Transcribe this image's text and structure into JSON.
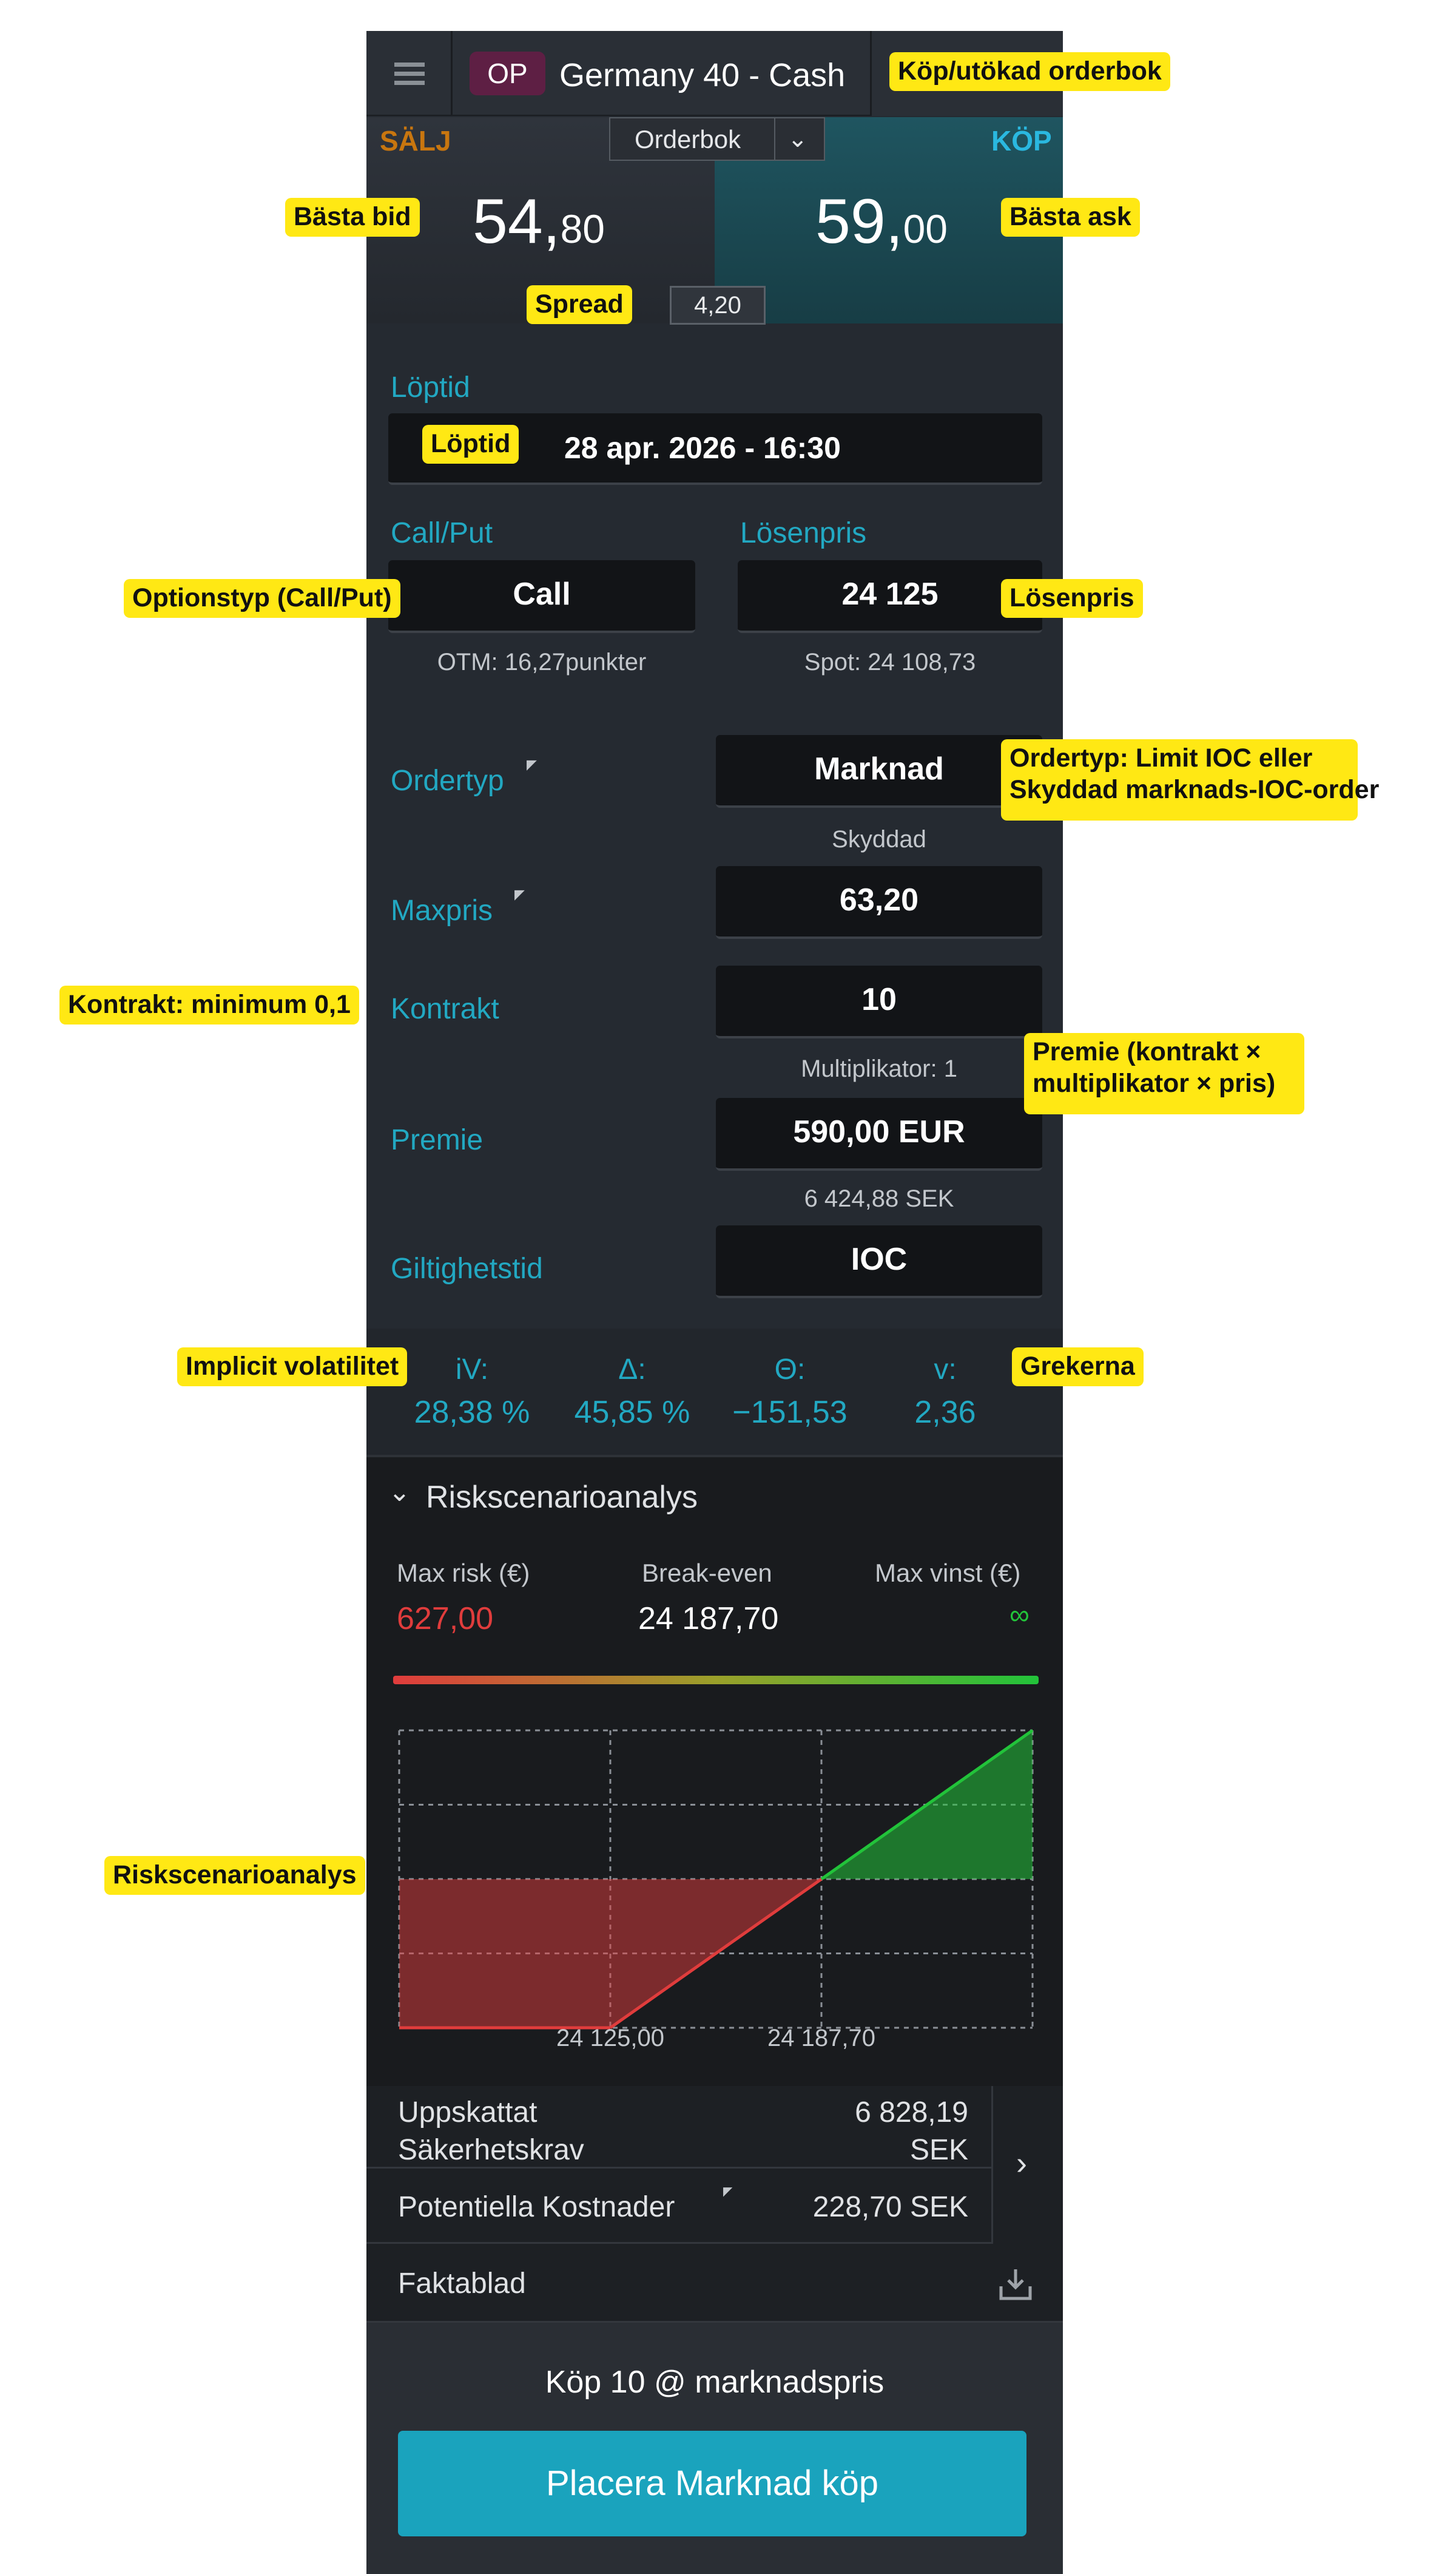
{
  "header": {
    "product_badge": "OP",
    "instrument": "Germany 40 - Cash",
    "badge_color": "#5e1f44"
  },
  "orderbook": {
    "sell_label": "SÄLJ",
    "buy_label": "KÖP",
    "selector_label": "Orderbok",
    "bid_int": "54,",
    "bid_dec": "80",
    "ask_int": "59,",
    "ask_dec": "00",
    "spread_value": "4,20"
  },
  "expiry": {
    "section_label": "Löptid",
    "value": "28 apr. 2026 - 16:30"
  },
  "option": {
    "type_label": "Call/Put",
    "type_value": "Call",
    "otm_note": "OTM: 16,27punkter",
    "strike_label": "Lösenpris",
    "strike_value": "24 125",
    "spot_note": "Spot: 24 108,73"
  },
  "order": {
    "type_label": "Ordertyp",
    "type_value": "Marknad",
    "type_note": "Skyddad",
    "maxprice_label": "Maxpris",
    "maxprice_value": "63,20",
    "contracts_label": "Kontrakt",
    "contracts_value": "10",
    "multiplier_note": "Multiplikator: 1",
    "premium_label": "Premie",
    "premium_value": "590,00 EUR",
    "premium_sek": "6 424,88 SEK",
    "validity_label": "Giltighetstid",
    "validity_value": "IOC"
  },
  "greeks": {
    "iv_label": "iV:",
    "iv_value": "28,38 %",
    "delta_label": "Δ:",
    "delta_value": "45,85 %",
    "theta_label": "Θ:",
    "theta_value": "−151,53",
    "vega_label": "v:",
    "vega_value": "2,36"
  },
  "risk": {
    "title": "Riskscenarioanalys",
    "max_risk_label": "Max risk (€)",
    "max_risk_value": "627,00",
    "breakeven_label": "Break-even",
    "breakeven_value": "24 187,70",
    "max_gain_label": "Max vinst (€)",
    "max_gain_value": "∞",
    "loss_color": "#e03c3c",
    "gain_color": "#22c33a",
    "chart_data": {
      "type": "area",
      "title": "",
      "xlabel": "",
      "ylabel": "",
      "x_ticks": [
        "24 125,00",
        "24 187,70"
      ],
      "strike": 24125.0,
      "break_even": 24187.7,
      "max_loss": -627.0,
      "max_gain": "∞",
      "series": [
        {
          "x": [
            24062.3,
            24125.0,
            24187.7,
            24250.4
          ],
          "y": [
            -627.0,
            -627.0,
            0,
            627.0
          ]
        }
      ],
      "grid": true
    }
  },
  "summary": {
    "margin_label_1": "Uppskattat",
    "margin_label_2": "Säkerhetskrav",
    "margin_value_1": "6 828,19",
    "margin_value_2": "SEK",
    "costs_label": "Potentiella Kostnader",
    "costs_value": "228,70 SEK",
    "factsheet_label": "Faktablad"
  },
  "footer": {
    "order_summary": "Köp 10 @ marknadspris",
    "submit_label": "Placera Marknad köp",
    "submit_color": "#1aa3bd"
  },
  "callouts": {
    "buy_orderbook": "Köp/utökad orderbok",
    "best_bid": "Bästa bid",
    "best_ask": "Bästa ask",
    "spread": "Spread",
    "expiry": "Löptid",
    "option_type": "Optionstyp (Call/Put)",
    "strike": "Lösenpris",
    "order_type_1": "Ordertyp: Limit IOC eller",
    "order_type_2": "Skyddad marknads-IOC-order",
    "contracts": "Kontrakt: minimum 0,1",
    "premium_1": "Premie (kontrakt ×",
    "premium_2": "multiplikator × pris)",
    "implied_vol": "Implicit volatilitet",
    "greeks": "Grekerna",
    "risk_analysis": "Riskscenarioanalys"
  }
}
